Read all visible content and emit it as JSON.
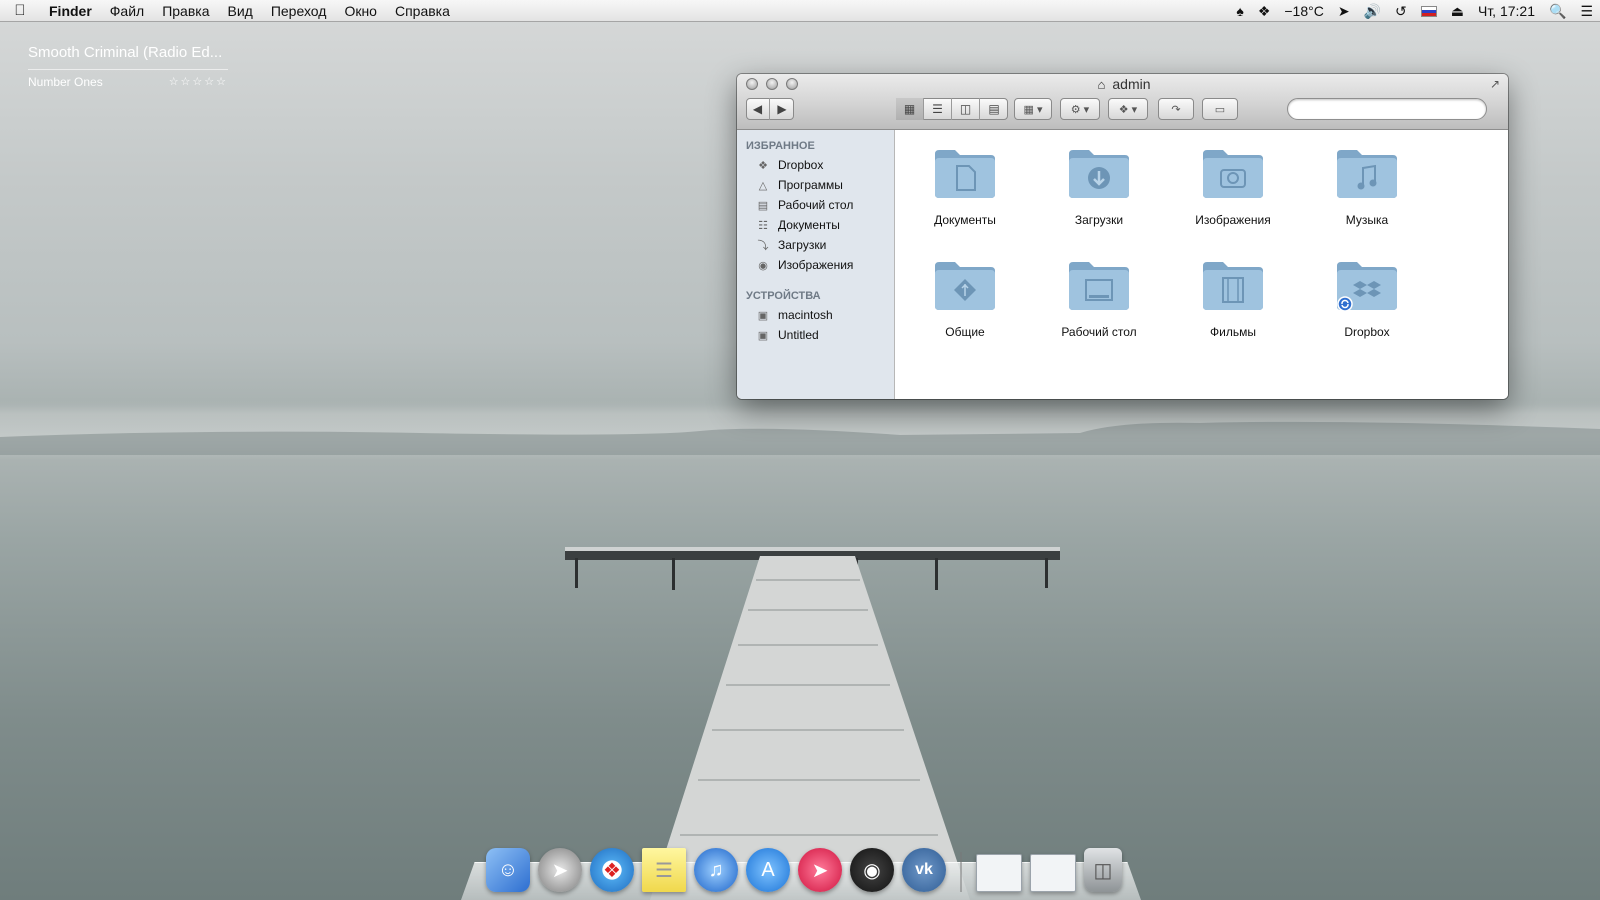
{
  "menubar": {
    "app_name": "Finder",
    "items": [
      "Файл",
      "Правка",
      "Вид",
      "Переход",
      "Окно",
      "Справка"
    ],
    "temperature": "−18°C",
    "clock": "Чт, 17:21"
  },
  "now_playing": {
    "title": "Smooth Criminal (Radio Ed...",
    "album": "Number Ones",
    "stars": "☆☆☆☆☆"
  },
  "window": {
    "title": "admin",
    "search_placeholder": "",
    "sidebar": {
      "favorites_heading": "ИЗБРАННОЕ",
      "favorites": [
        "Dropbox",
        "Программы",
        "Рабочий стол",
        "Документы",
        "Загрузки",
        "Изображения"
      ],
      "devices_heading": "УСТРОЙСТВА",
      "devices": [
        "macintosh",
        "Untitled"
      ]
    },
    "folders": [
      "Документы",
      "Загрузки",
      "Изображения",
      "Музыка",
      "Общие",
      "Рабочий стол",
      "Фильмы",
      "Dropbox"
    ]
  },
  "colors": {
    "folder_blue": "#8fb5d3",
    "sidebar_bg": "#e0e6ed"
  },
  "dock": {
    "apps": [
      "finder-icon",
      "launchpad-icon",
      "safari-icon",
      "notes-icon",
      "itunes-icon",
      "app-store-icon",
      "sparrow-icon",
      "dvd-player-icon",
      "vk-icon"
    ],
    "documents": [
      "stack-icon-1",
      "stack-icon-2"
    ],
    "trash": "trash-icon"
  }
}
